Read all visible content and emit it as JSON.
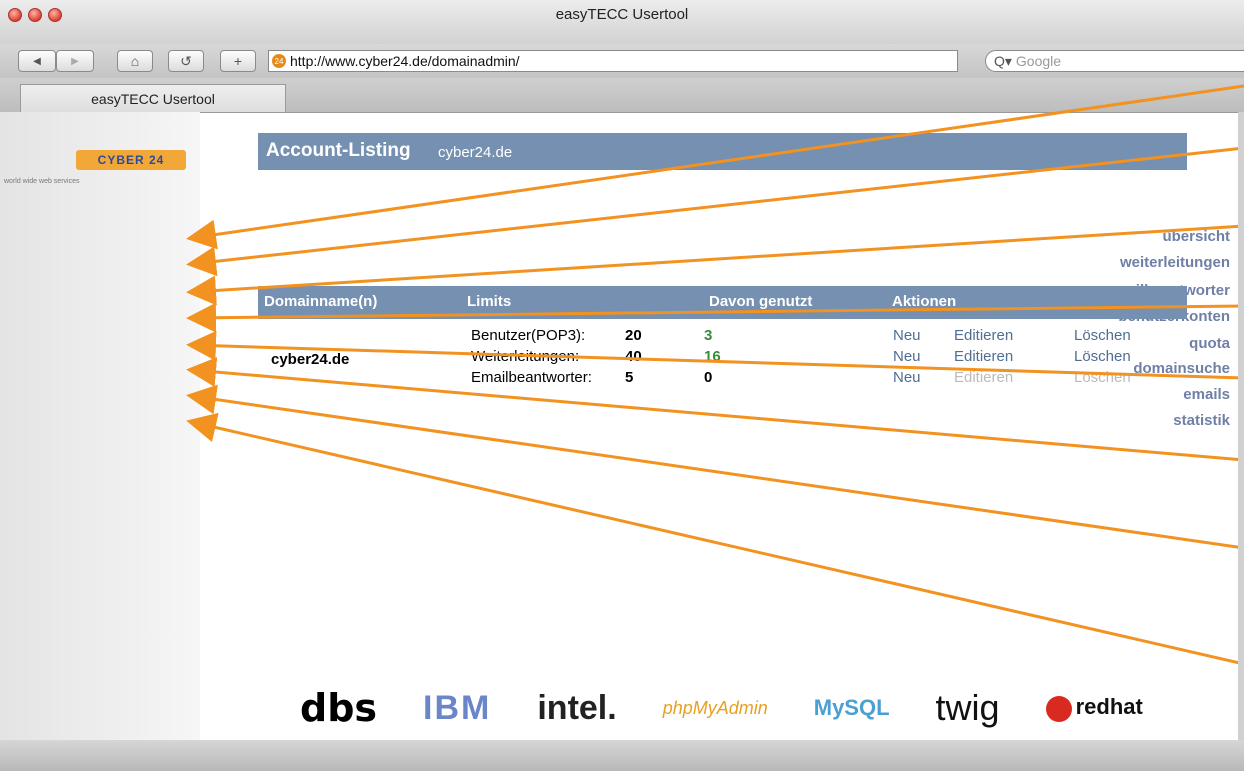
{
  "window": {
    "title": "easyTECC Usertool"
  },
  "toolbar": {
    "back": "◀",
    "forward": "▶",
    "home": "⌂",
    "reload": "↺",
    "add": "+",
    "favicon_text": "24",
    "url": "http://www.cyber24.de/domainadmin/",
    "search_placeholder": "Google"
  },
  "tab": {
    "label": "easyTECC Usertool"
  },
  "sidebar": {
    "logo_text": "CYBER 24",
    "logo_sub": "world wide web services",
    "items": [
      "übersicht",
      "weiterleitungen",
      "emailbeantworter",
      "benutzerkonten",
      "quota",
      "domainsuche",
      "emails",
      "statistik"
    ]
  },
  "header": {
    "title": "Account-Listing",
    "domain": "cyber24.de"
  },
  "table": {
    "columns": [
      "Domainname(n)",
      "Limits",
      "Davon genutzt",
      "Aktionen"
    ],
    "domain": "cyber24.de",
    "rows": [
      {
        "label": "Benutzer(POP3):",
        "limit": "20",
        "used": "3",
        "actions": [
          "Neu",
          "Editieren",
          "Löschen"
        ]
      },
      {
        "label": "Weiterleitungen:",
        "limit": "40",
        "used": "16",
        "actions": [
          "Neu",
          "Editieren",
          "Löschen"
        ]
      },
      {
        "label": "Emailbeantworter:",
        "limit": "5",
        "used": "0",
        "actions": [
          "Neu",
          "Editieren",
          "Löschen"
        ]
      }
    ]
  },
  "logos": [
    "dbs",
    "IBM",
    "intel.",
    "phpMyAdmin",
    "MySQL",
    "twig",
    "redhat"
  ],
  "colors": {
    "accent": "#7590b0",
    "arrow": "#f29220",
    "nav": "#6f7fa6"
  }
}
